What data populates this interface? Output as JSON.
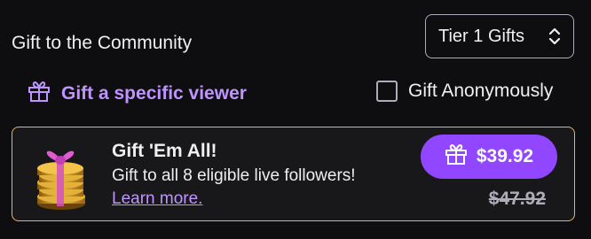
{
  "header": {
    "title": "Gift to the Community",
    "tier_select": {
      "value": "Tier 1 Gifts",
      "icon": "chevron-updown-icon"
    }
  },
  "options": {
    "specific_viewer_label": "Gift a specific viewer",
    "specific_viewer_icon": "gift-icon",
    "anonymous_label": "Gift Anonymously",
    "anonymous_checked": false
  },
  "offer": {
    "title": "Gift 'Em All!",
    "description": "Gift to all 8 eligible live followers!",
    "learn_more": "Learn more.",
    "price": "$39.92",
    "original_price": "$47.92",
    "image": "gift-coins-icon"
  },
  "colors": {
    "accent": "#bf94ff",
    "button": "#9147ff",
    "card_border": "#e6b857",
    "background": "#0e0e10"
  }
}
